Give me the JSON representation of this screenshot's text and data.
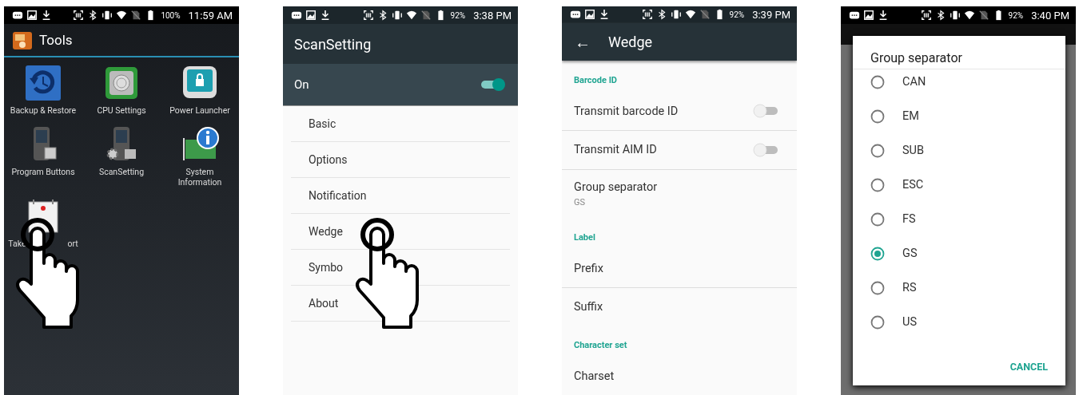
{
  "screens": [
    {
      "kind": "launcher",
      "status_bar": {
        "battery": "100%",
        "time": "11:59 AM"
      },
      "title": "Tools",
      "touch_on_item": true,
      "apps": [
        {
          "kind": "backup",
          "label_parts": [
            "Backup & Restore"
          ]
        },
        {
          "kind": "cpu",
          "label_parts": [
            "CPU Settings"
          ]
        },
        {
          "kind": "lock",
          "label_parts": [
            "Power Launcher"
          ]
        },
        {
          "kind": "device",
          "label_parts": [
            "Program Buttons"
          ]
        },
        {
          "kind": "device-gear",
          "label_parts": [
            "ScanSetting"
          ]
        },
        {
          "kind": "info",
          "label_parts": [
            "System",
            "Information"
          ]
        },
        {
          "kind": "calendar",
          "label_parts": [
            "Take",
            "ort"
          ]
        }
      ]
    },
    {
      "kind": "menu",
      "status_bar": {
        "battery": "92%",
        "time": "3:38 PM"
      },
      "title": "ScanSetting",
      "master_switch": {
        "label": "On",
        "on": true
      },
      "touch_on_item": true,
      "items": [
        {
          "label": "Basic"
        },
        {
          "label": "Options"
        },
        {
          "label": "Notification"
        },
        {
          "label": "Wedge"
        },
        {
          "label": "Symbo"
        },
        {
          "label": "About"
        }
      ]
    },
    {
      "kind": "settings",
      "status_bar": {
        "battery": "92%",
        "time": "3:39 PM"
      },
      "title": "Wedge",
      "back": "←",
      "rows": [
        {
          "kind": "header",
          "label": "Barcode ID"
        },
        {
          "kind": "switch",
          "label": "Transmit barcode ID",
          "on": false
        },
        {
          "kind": "switch",
          "label": "Transmit AIM ID",
          "on": false
        },
        {
          "kind": "summary",
          "label": "Group separator",
          "summary": "GS"
        },
        {
          "kind": "header",
          "label": "Label"
        },
        {
          "kind": "plain",
          "label": "Prefix"
        },
        {
          "kind": "plain",
          "label": "Suffix"
        },
        {
          "kind": "header",
          "label": "Character set"
        },
        {
          "kind": "plain",
          "label": "Charset"
        }
      ]
    },
    {
      "kind": "dialog",
      "status_bar": {
        "battery": "92%",
        "time": "3:40 PM"
      },
      "dialog_title": "Group separator",
      "button": "CANCEL",
      "options": [
        {
          "label": "CAN",
          "selected": false
        },
        {
          "label": "EM",
          "selected": false
        },
        {
          "label": "SUB",
          "selected": false
        },
        {
          "label": "ESC",
          "selected": false
        },
        {
          "label": "FS",
          "selected": false
        },
        {
          "label": "GS",
          "selected": true
        },
        {
          "label": "RS",
          "selected": false
        },
        {
          "label": "US",
          "selected": false
        }
      ]
    }
  ]
}
